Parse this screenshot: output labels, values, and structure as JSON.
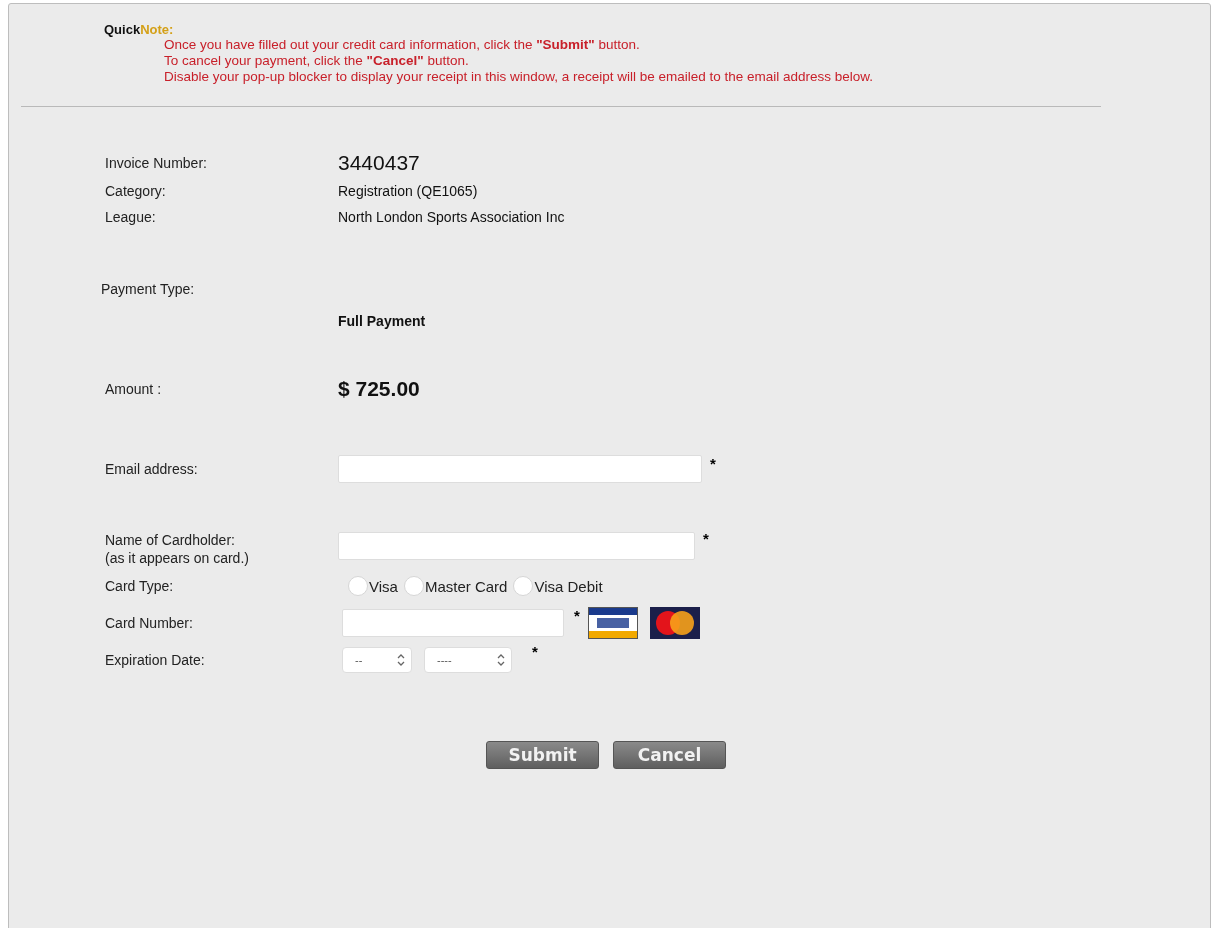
{
  "quick_note": {
    "title_first": "Quick",
    "title_second": "Note:",
    "lines": [
      "Once you have filled out your credit card information, click the **\"Submit\"** button.",
      "To cancel your payment, click the **\"Cancel\"** button.",
      "Disable your pop-up blocker to display your receipt in this window, a receipt will be emailed to the email address below."
    ]
  },
  "details": [
    {
      "label": "Invoice Number:",
      "value": "3440437",
      "kind": "large"
    },
    {
      "label": "Category:",
      "value": "Registration (QE1065)",
      "kind": "plain"
    },
    {
      "label": "League:",
      "value": "North London Sports Association Inc",
      "kind": "plain"
    }
  ],
  "payment_type": {
    "label": "Payment Type:",
    "value": "Full Payment"
  },
  "amount": {
    "label": "Amount :",
    "value": "$ 725.00"
  },
  "email": {
    "label": "Email address:",
    "required_mark": "*"
  },
  "cardholder": {
    "label": "Name of Cardholder:",
    "hint": "(as it appears on card.)",
    "required_mark": "*"
  },
  "card_type": {
    "label": "Card Type:",
    "options": [
      {
        "label": "Visa",
        "selected": false
      },
      {
        "label": "Master Card",
        "selected": false
      },
      {
        "label": "Visa Debit",
        "selected": false
      }
    ]
  },
  "card_number": {
    "label": "Card Number:",
    "required_mark": "*"
  },
  "expiration": {
    "label": "Expiration Date:",
    "selects": [
      {
        "value": "--"
      },
      {
        "value": "----"
      }
    ],
    "required_mark": "*"
  },
  "buttons": [
    "Submit",
    "Cancel"
  ]
}
